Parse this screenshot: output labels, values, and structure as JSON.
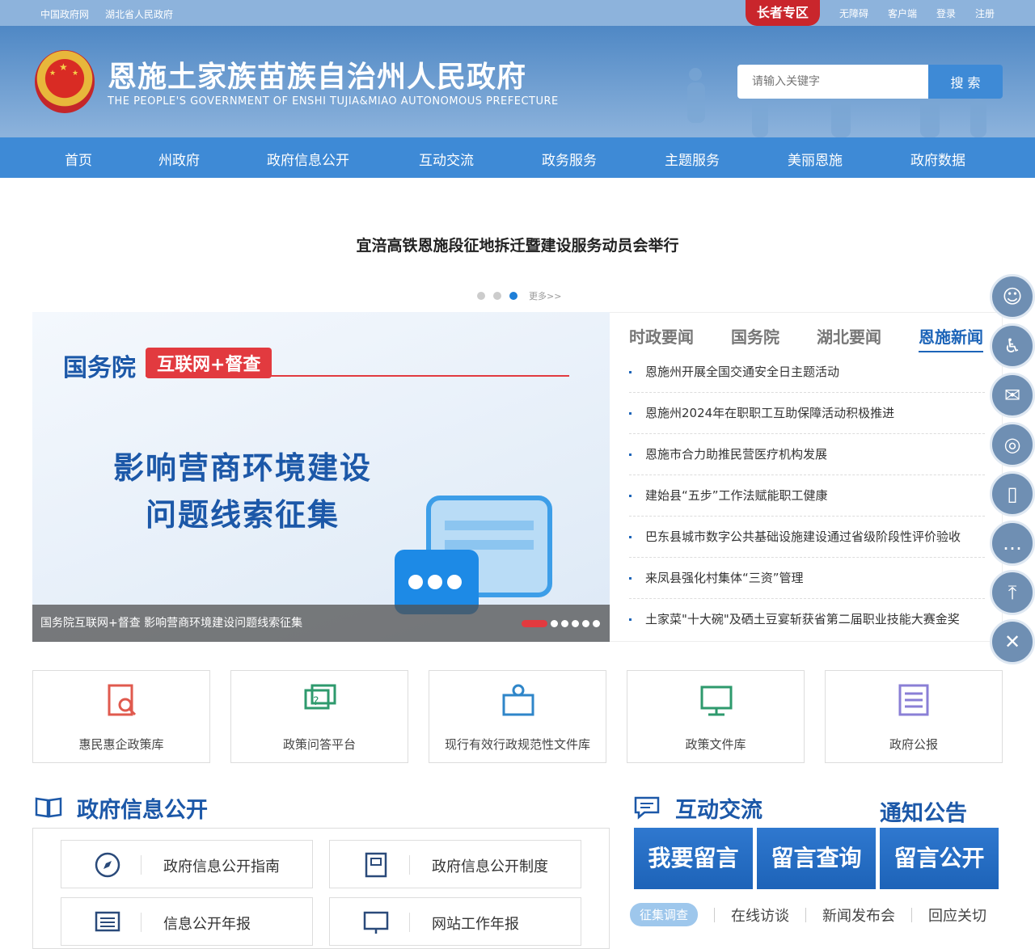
{
  "topbar": {
    "links_left": [
      "中国政府网",
      "湖北省人民政府"
    ],
    "elder_zone": "长者专区",
    "links_right": [
      "无障碍",
      "客户端",
      "登录",
      "注册"
    ]
  },
  "header": {
    "title": "恩施土家族苗族自治州人民政府",
    "subtitle": "THE PEOPLE'S GOVERNMENT OF ENSHI TUJIA&MIAO AUTONOMOUS PREFECTURE",
    "search_placeholder": "请输入关键字",
    "search_button": "搜 索"
  },
  "nav": [
    "首页",
    "州政府",
    "政府信息公开",
    "互动交流",
    "政务服务",
    "主题服务",
    "美丽恩施",
    "政府数据"
  ],
  "headline": {
    "title": "宜涪高铁恩施段征地拆迁暨建设服务动员会举行",
    "more": "更多>>"
  },
  "banner": {
    "org": "国务院",
    "tag": "互联网+督查",
    "line1": "影响营商环境建设",
    "line2": "问题线索征集",
    "caption": "国务院互联网+督查 影响营商环境建设问题线索征集"
  },
  "news": {
    "tabs": [
      "时政要闻",
      "国务院",
      "湖北要闻",
      "恩施新闻"
    ],
    "items": [
      "恩施州开展全国交通安全日主题活动",
      "恩施州2024年在职职工互助保障活动积极推进",
      "恩施市合力助推民营医疗机构发展",
      "建始县“五步”工作法赋能职工健康",
      "巴东县城市数字公共基础设施建设通过省级阶段性评价验收",
      "来凤县强化村集体“三资”管理",
      "土家菜\"十大碗\"及硒土豆宴斩获省第二届职业技能大赛金奖"
    ]
  },
  "cards": [
    "惠民惠企政策库",
    "政策问答平台",
    "现行有效行政规范性文件库",
    "政策文件库",
    "政府公报"
  ],
  "sections": {
    "info_title": "政府信息公开",
    "info_items": [
      "政府信息公开指南",
      "政府信息公开制度",
      "信息公开年报",
      "网站工作年报"
    ],
    "interact_title": "互动交流",
    "notice_title": "通知公告",
    "big_buttons": [
      "我要留言",
      "留言查询",
      "留言公开"
    ],
    "subtabs": [
      "征集调查",
      "在线访谈",
      "新闻发布会",
      "回应关切"
    ]
  },
  "colors": {
    "accent": "#3e8ad6",
    "title_blue": "#1c58a8",
    "red": "#c9262c"
  }
}
